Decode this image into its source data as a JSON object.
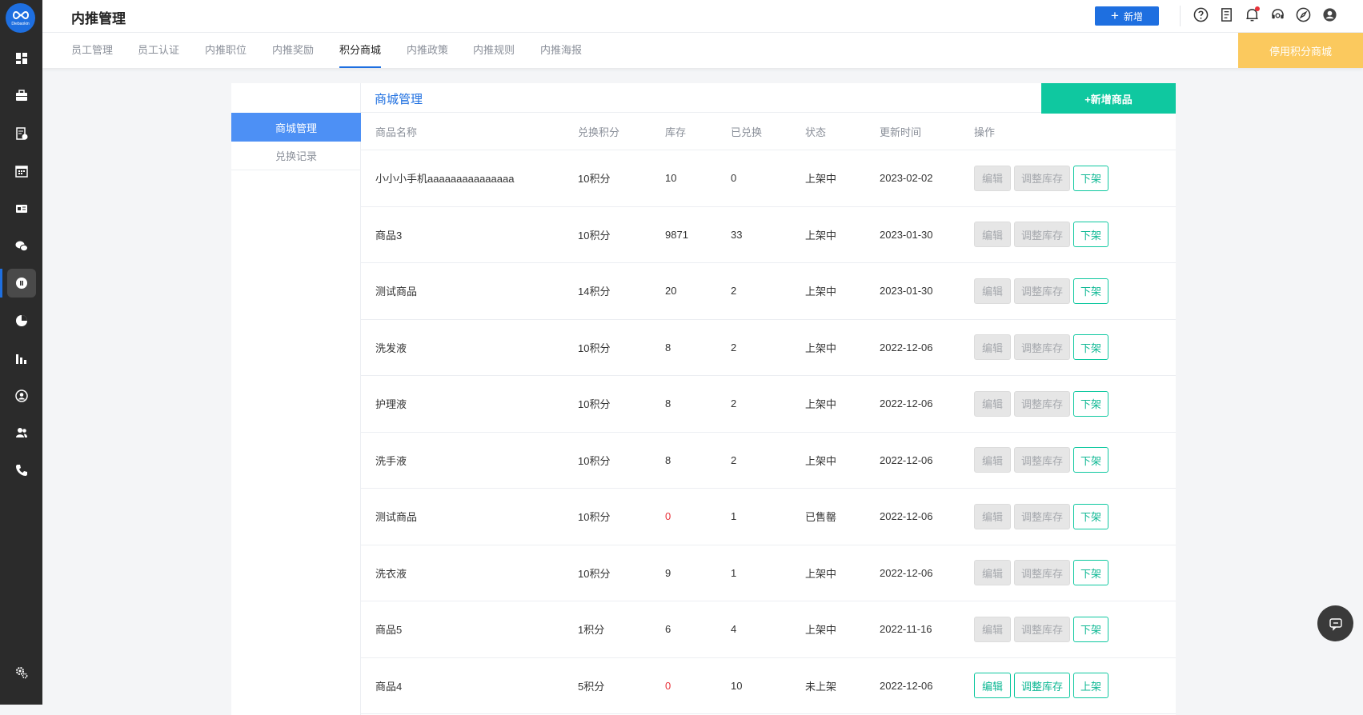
{
  "sidebar": {
    "logo_text": "Diebaokin",
    "items": [
      {
        "icon": "dashboard-icon"
      },
      {
        "icon": "briefcase-icon"
      },
      {
        "icon": "resume-icon"
      },
      {
        "icon": "calendar-icon"
      },
      {
        "icon": "id-card-icon"
      },
      {
        "icon": "wechat-icon"
      },
      {
        "icon": "referral-icon",
        "active": true
      },
      {
        "icon": "pie-chart-icon"
      },
      {
        "icon": "bar-chart-icon"
      },
      {
        "icon": "person-circle-icon"
      },
      {
        "icon": "users-icon"
      },
      {
        "icon": "phone-icon"
      }
    ],
    "settings_icon": "settings-icon"
  },
  "header": {
    "title": "内推管理",
    "new_button": "新增",
    "icons": [
      "help-icon",
      "document-icon",
      "bell-icon",
      "support-icon",
      "compass-icon",
      "user-icon"
    ]
  },
  "tabs": [
    {
      "label": "员工管理"
    },
    {
      "label": "员工认证"
    },
    {
      "label": "内推职位"
    },
    {
      "label": "内推奖励"
    },
    {
      "label": "积分商城",
      "active": true
    },
    {
      "label": "内推政策"
    },
    {
      "label": "内推规则"
    },
    {
      "label": "内推海报"
    }
  ],
  "disable_mall_button": "停用积分商城",
  "subnav": [
    {
      "label": "商城管理",
      "active": true
    },
    {
      "label": "兑换记录"
    }
  ],
  "main": {
    "title": "商城管理",
    "add_button": "+新增商品"
  },
  "table": {
    "columns": [
      "商品名称",
      "兑换积分",
      "库存",
      "已兑换",
      "状态",
      "更新时间",
      "操作"
    ],
    "rows": [
      {
        "name": "小小小手机aaaaaaaaaaaaaaa",
        "points": "10积分",
        "stock": "10",
        "exchanged": "0",
        "status": "上架中",
        "updated": "2023-02-02",
        "ops": [
          "编辑",
          "调整库存",
          "下架"
        ],
        "editable": false
      },
      {
        "name": "商品3",
        "points": "10积分",
        "stock": "9871",
        "exchanged": "33",
        "status": "上架中",
        "updated": "2023-01-30",
        "ops": [
          "编辑",
          "调整库存",
          "下架"
        ],
        "editable": false
      },
      {
        "name": "测试商品",
        "points": "14积分",
        "stock": "20",
        "exchanged": "2",
        "status": "上架中",
        "updated": "2023-01-30",
        "ops": [
          "编辑",
          "调整库存",
          "下架"
        ],
        "editable": false
      },
      {
        "name": "洗发液",
        "points": "10积分",
        "stock": "8",
        "exchanged": "2",
        "status": "上架中",
        "updated": "2022-12-06",
        "ops": [
          "编辑",
          "调整库存",
          "下架"
        ],
        "editable": false
      },
      {
        "name": "护理液",
        "points": "10积分",
        "stock": "8",
        "exchanged": "2",
        "status": "上架中",
        "updated": "2022-12-06",
        "ops": [
          "编辑",
          "调整库存",
          "下架"
        ],
        "editable": false
      },
      {
        "name": "洗手液",
        "points": "10积分",
        "stock": "8",
        "exchanged": "2",
        "status": "上架中",
        "updated": "2022-12-06",
        "ops": [
          "编辑",
          "调整库存",
          "下架"
        ],
        "editable": false
      },
      {
        "name": "测试商品",
        "points": "10积分",
        "stock": "0",
        "exchanged": "1",
        "status": "已售罄",
        "updated": "2022-12-06",
        "ops": [
          "编辑",
          "调整库存",
          "下架"
        ],
        "editable": false
      },
      {
        "name": "洗衣液",
        "points": "10积分",
        "stock": "9",
        "exchanged": "1",
        "status": "上架中",
        "updated": "2022-12-06",
        "ops": [
          "编辑",
          "调整库存",
          "下架"
        ],
        "editable": false
      },
      {
        "name": "商品5",
        "points": "1积分",
        "stock": "6",
        "exchanged": "4",
        "status": "上架中",
        "updated": "2022-11-16",
        "ops": [
          "编辑",
          "调整库存",
          "下架"
        ],
        "editable": false
      },
      {
        "name": "商品4",
        "points": "5积分",
        "stock": "0",
        "exchanged": "10",
        "status": "未上架",
        "updated": "2022-12-06",
        "ops": [
          "编辑",
          "调整库存",
          "上架"
        ],
        "editable": true
      }
    ]
  },
  "colors": {
    "primary": "#1e6fe0",
    "accent_green": "#0fc8a0",
    "warning_yellow": "#fbc95e",
    "danger_red": "#e8323a",
    "sidebar_bg": "#2b2b2b"
  },
  "chat_icon": "chat-icon"
}
